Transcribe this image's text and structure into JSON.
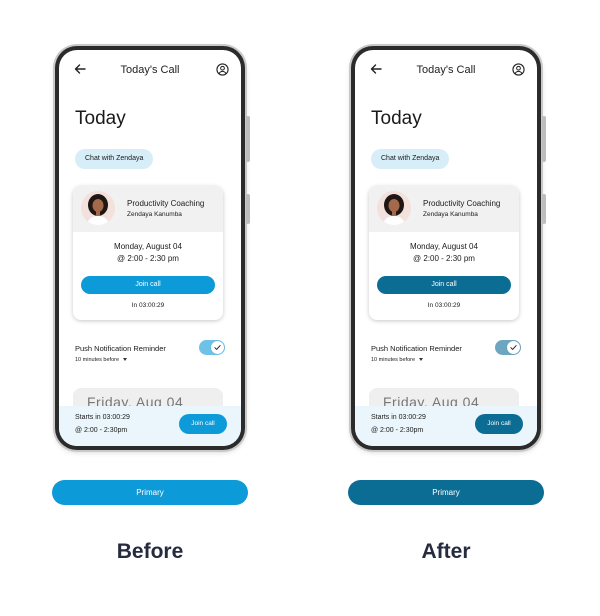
{
  "colors": {
    "before_accent": "#0d9ad8",
    "after_accent": "#0b6d94",
    "caption_text": "#262b3f"
  },
  "columns": [
    {
      "caption": "Before",
      "screen": {
        "topbar_title": "Today's Call",
        "heading": "Today",
        "chip_label": "Chat with Zendaya",
        "card": {
          "title": "Productivity Coaching",
          "coach_name": "Zendaya Kanumba",
          "date": "Monday, August 04",
          "time": "@ 2:00 - 2:30 pm",
          "join_label": "Join call",
          "countdown": "In 03:00:29"
        },
        "push": {
          "label": "Push Notification Reminder",
          "sub": "10 minutes before",
          "enabled": true
        },
        "peek_text": "Friday, Aug 04",
        "bottom": {
          "starts": "Starts in 03:00:29",
          "time": "@ 2:00 - 2:30pm",
          "join_label": "Join call"
        }
      },
      "primary_label": "Primary"
    },
    {
      "caption": "After",
      "screen": {
        "topbar_title": "Today's Call",
        "heading": "Today",
        "chip_label": "Chat with Zendaya",
        "card": {
          "title": "Productivity Coaching",
          "coach_name": "Zendaya Kanumba",
          "date": "Monday, August 04",
          "time": "@ 2:00 - 2:30 pm",
          "join_label": "Join call",
          "countdown": "In 03:00:29"
        },
        "push": {
          "label": "Push Notification Reminder",
          "sub": "10 minutes before",
          "enabled": true
        },
        "peek_text": "Friday, Aug 04",
        "bottom": {
          "starts": "Starts in 03:00:29",
          "time": "@ 2:00 - 2:30pm",
          "join_label": "Join call"
        }
      },
      "primary_label": "Primary"
    }
  ]
}
